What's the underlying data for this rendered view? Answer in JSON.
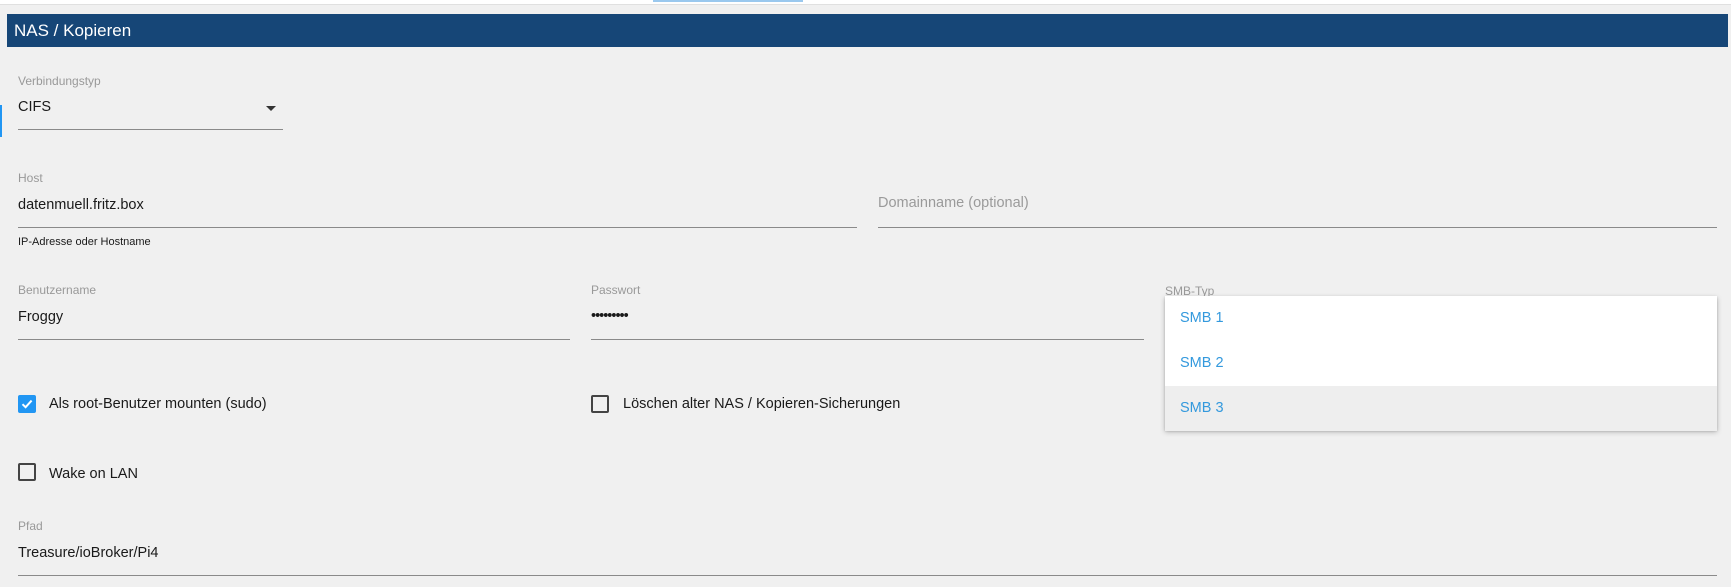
{
  "section": {
    "title": "NAS / Kopieren"
  },
  "connection_type": {
    "label": "Verbindungstyp",
    "value": "CIFS"
  },
  "host": {
    "label": "Host",
    "value": "datenmuell.fritz.box",
    "helper": "IP-Adresse oder Hostname"
  },
  "domain": {
    "placeholder": "Domainname (optional)"
  },
  "username": {
    "label": "Benutzername",
    "value": "Froggy"
  },
  "password": {
    "label": "Passwort",
    "value": "•••••••••"
  },
  "smb_type": {
    "label": "SMB-Typ",
    "options": [
      "SMB 1",
      "SMB 2",
      "SMB 3"
    ],
    "highlighted": "SMB 3"
  },
  "options": {
    "sudo_label": "Als root-Benutzer mounten (sudo)",
    "sudo_checked": true,
    "delete_label": "Löschen alter NAS / Kopieren-Sicherungen",
    "delete_checked": false,
    "wol_label": "Wake on LAN",
    "wol_checked": false
  },
  "path": {
    "label": "Pfad",
    "value": "Treasure/ioBroker/Pi4"
  },
  "colors": {
    "header_bg": "#164677",
    "accent": "#2196f3",
    "option_text": "#3399dd",
    "background": "#f0f0f0"
  }
}
